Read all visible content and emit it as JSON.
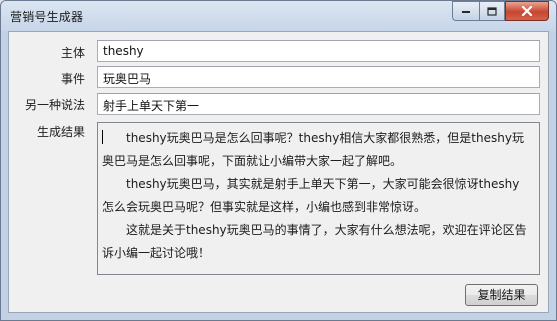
{
  "window": {
    "title": "营销号生成器",
    "controls": {
      "minimize_icon": "minimize-icon",
      "maximize_icon": "maximize-icon",
      "close_icon": "close-icon",
      "close_color": "#c8462f"
    }
  },
  "form": {
    "subject": {
      "label": "主体",
      "value": "theshy"
    },
    "event": {
      "label": "事件",
      "value": "玩奥巴马"
    },
    "alt_phrase": {
      "label": "另一种说法",
      "value": "射手上单天下第一"
    },
    "result": {
      "label": "生成结果",
      "paragraphs": [
        "theshy玩奥巴马是怎么回事呢？theshy相信大家都很熟悉，但是theshy玩奥巴马是怎么回事呢，下面就让小编带大家一起了解吧。",
        "theshy玩奥巴马，其实就是射手上单天下第一，大家可能会很惊讶theshy怎么会玩奥巴马呢？但事实就是这样，小编也感到非常惊讶。",
        "这就是关于theshy玩奥巴马的事情了，大家有什么想法呢，欢迎在评论区告诉小编一起讨论哦！"
      ]
    }
  },
  "actions": {
    "copy_label": "复制结果"
  }
}
